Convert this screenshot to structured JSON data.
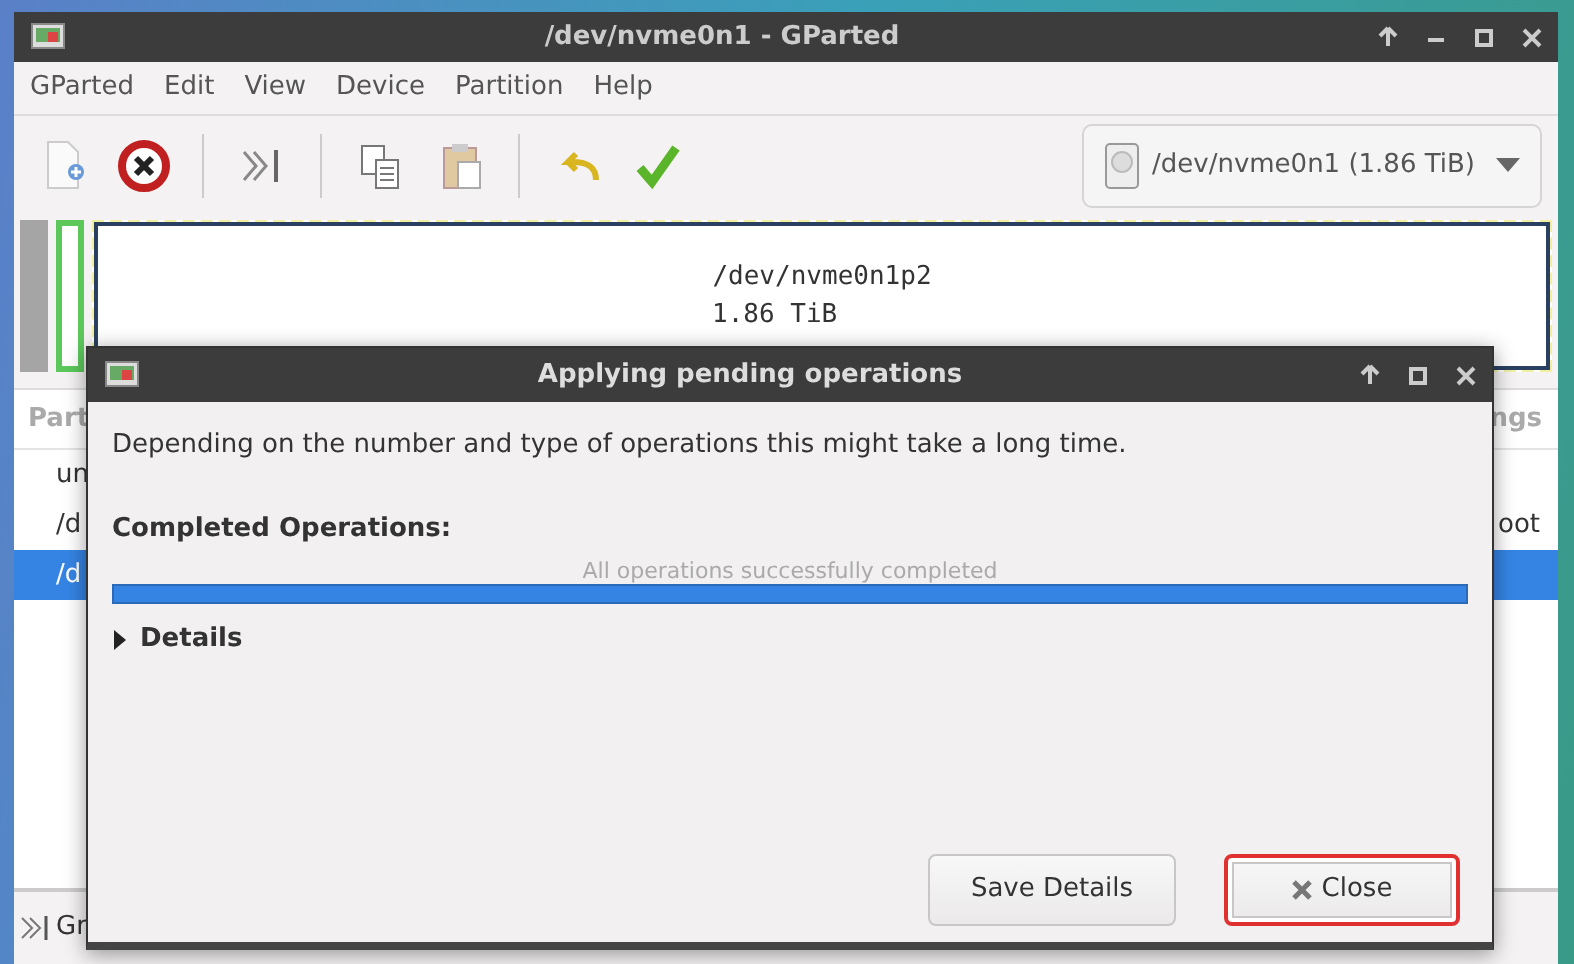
{
  "main_window": {
    "title": "/dev/nvme0n1 - GParted",
    "menu": [
      "GParted",
      "Edit",
      "View",
      "Device",
      "Partition",
      "Help"
    ],
    "toolbar": [
      {
        "kind": "new"
      },
      {
        "kind": "delete"
      },
      {
        "kind": "sep"
      },
      {
        "kind": "resize"
      },
      {
        "kind": "sep"
      },
      {
        "kind": "copy"
      },
      {
        "kind": "paste"
      },
      {
        "kind": "sep"
      },
      {
        "kind": "undo"
      },
      {
        "kind": "apply"
      }
    ],
    "device": "/dev/nvme0n1 (1.86 TiB)",
    "disk_graph": [
      {
        "color": "#a5a5a5",
        "selected": false
      },
      {
        "color": "#5cc85c",
        "selected": false
      },
      {
        "color": "#ffffff",
        "selected": true,
        "name": "/dev/nvme0n1p2",
        "size": "1.86 TiB"
      }
    ],
    "partition_list": {
      "columns": [
        "Part",
        "ngs"
      ],
      "rows": [
        {
          "column_1": "un",
          "selected": false
        },
        {
          "column_1": "/d",
          "column_2": "oot",
          "selected": false
        },
        {
          "column_1": "/d",
          "selected": true
        }
      ]
    },
    "status_bar": "Gr"
  },
  "dialog": {
    "title": "Applying pending operations",
    "message": "Depending on the number and type of operations this might take a long time.",
    "heading": "Completed Operations:",
    "progress_text": "All operations successfully completed",
    "level": 1,
    "details": {
      "label": "Details",
      "expanded": false
    },
    "buttons": [
      {
        "label": "Save Details",
        "kind": "save",
        "highlighted": false
      },
      {
        "label": "Close",
        "kind": "close",
        "highlighted": true
      }
    ]
  }
}
